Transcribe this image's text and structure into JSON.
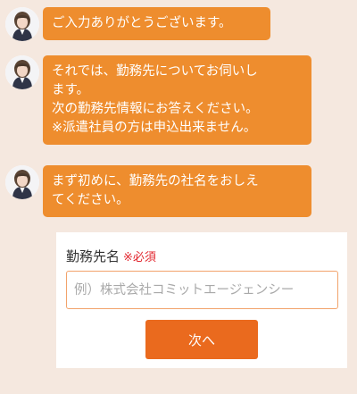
{
  "colors": {
    "background": "#f5e8df",
    "bubble": "#ee8d2e",
    "button": "#ea6a1e",
    "required": "#e2262e",
    "input_border": "#f2a36b"
  },
  "chat": {
    "avatar_icon": "operator-avatar-icon",
    "messages": [
      {
        "lines": [
          "ご入力ありがとうございます。"
        ]
      },
      {
        "lines": [
          "それでは、勤務先についてお伺いし",
          "ます。",
          "次の勤務先情報にお答えください。",
          "※派遣社員の方は申込出来ません。"
        ]
      },
      {
        "lines": [
          "まず初めに、勤務先の社名をおしえ",
          "てください。"
        ]
      }
    ]
  },
  "form": {
    "label": "勤務先名",
    "required": "※必須",
    "placeholder": "例）株式会社コミットエージェンシー",
    "value": "",
    "next_button": "次へ"
  }
}
